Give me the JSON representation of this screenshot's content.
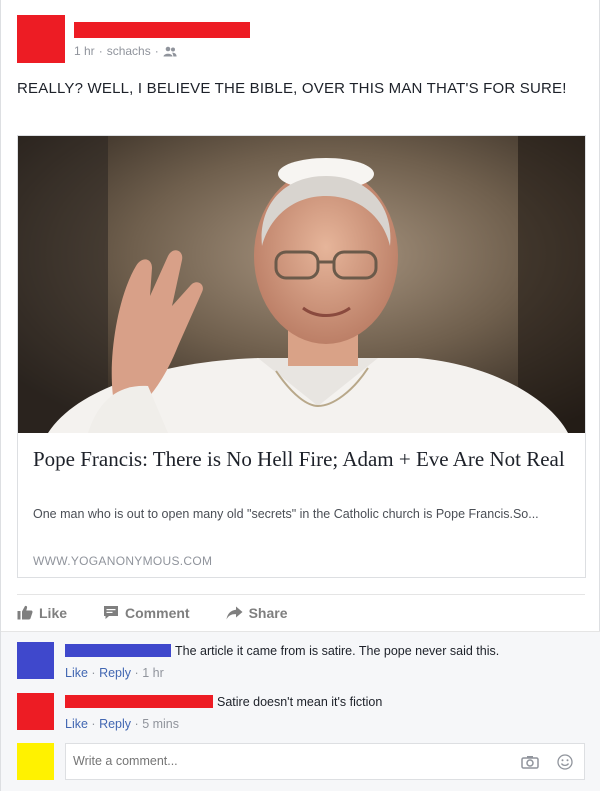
{
  "post": {
    "meta": {
      "time": "1 hr",
      "separator": "·",
      "location": "schachs"
    },
    "status_text": "REALLY? WELL, I BELIEVE THE BIBLE, OVER THIS MAN THAT'S FOR SURE!",
    "colors": {
      "redact_red": "#ed1c24",
      "redact_blue": "#3f48cc",
      "redact_yellow": "#fff200",
      "link_blue": "#4267b2"
    }
  },
  "link_card": {
    "image_icon": "photo-of-pope-waving",
    "title": "Pope Francis: There is No Hell Fire; Adam + Eve Are Not Real",
    "description": "One man who is out to open many old \"secrets\" in the Catholic church is Pope Francis.So...",
    "domain": "WWW.YOGANONYMOUS.COM"
  },
  "actions": {
    "like": "Like",
    "comment": "Comment",
    "share": "Share"
  },
  "comments": [
    {
      "text": "The article it came from is satire. The pope never said this.",
      "like": "Like",
      "reply": "Reply",
      "sep": "·",
      "time": "1 hr"
    },
    {
      "text": "Satire doesn't mean it's fiction",
      "like": "Like",
      "reply": "Reply",
      "sep": "·",
      "time": "5 mins"
    }
  ],
  "composer": {
    "placeholder": "Write a comment..."
  }
}
